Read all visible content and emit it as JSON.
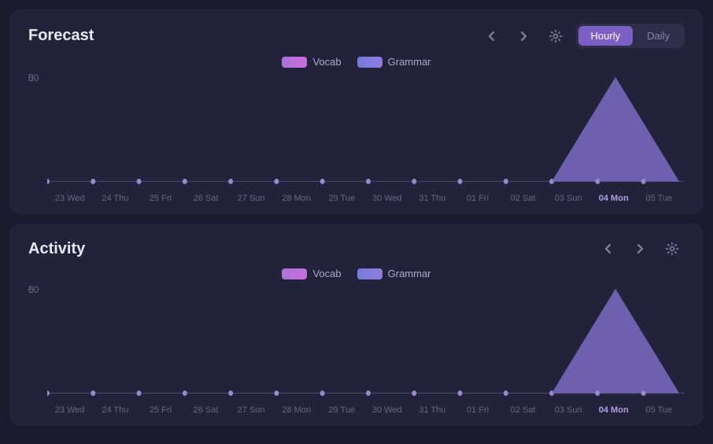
{
  "forecast": {
    "title": "Forecast",
    "legend": {
      "vocab_label": "Vocab",
      "grammar_label": "Grammar"
    },
    "y_axis": {
      "top": "50",
      "bottom": "0"
    },
    "x_labels": [
      {
        "text": "23 Wed",
        "highlighted": false
      },
      {
        "text": "24 Thu",
        "highlighted": false
      },
      {
        "text": "25 Fri",
        "highlighted": false
      },
      {
        "text": "26 Sat",
        "highlighted": false
      },
      {
        "text": "27 Sun",
        "highlighted": false
      },
      {
        "text": "28 Mon",
        "highlighted": false
      },
      {
        "text": "29 Tue",
        "highlighted": false
      },
      {
        "text": "30 Wed",
        "highlighted": false
      },
      {
        "text": "31 Thu",
        "highlighted": false
      },
      {
        "text": "01 Fri",
        "highlighted": false
      },
      {
        "text": "02 Sat",
        "highlighted": false
      },
      {
        "text": "03 Sun",
        "highlighted": false
      },
      {
        "text": "04 Mon",
        "highlighted": true
      },
      {
        "text": "05 Tue",
        "highlighted": false
      }
    ],
    "nav": {
      "prev": "←",
      "next": "→"
    }
  },
  "activity": {
    "title": "Activity",
    "legend": {
      "vocab_label": "Vocab",
      "grammar_label": "Grammar"
    },
    "y_axis": {
      "top": "50",
      "bottom": "0"
    },
    "x_labels": [
      {
        "text": "23 Wed",
        "highlighted": false
      },
      {
        "text": "24 Thu",
        "highlighted": false
      },
      {
        "text": "25 Fri",
        "highlighted": false
      },
      {
        "text": "26 Sat",
        "highlighted": false
      },
      {
        "text": "27 Sun",
        "highlighted": false
      },
      {
        "text": "28 Mon",
        "highlighted": false
      },
      {
        "text": "29 Tue",
        "highlighted": false
      },
      {
        "text": "30 Wed",
        "highlighted": false
      },
      {
        "text": "31 Thu",
        "highlighted": false
      },
      {
        "text": "01 Fri",
        "highlighted": false
      },
      {
        "text": "02 Sat",
        "highlighted": false
      },
      {
        "text": "03 Sun",
        "highlighted": false
      },
      {
        "text": "04 Mon",
        "highlighted": true
      },
      {
        "text": "05 Tue",
        "highlighted": false
      }
    ],
    "nav": {
      "prev": "←",
      "next": "→"
    }
  },
  "toggle": {
    "hourly_label": "Hourly",
    "daily_label": "Daily",
    "active": "Hourly"
  }
}
